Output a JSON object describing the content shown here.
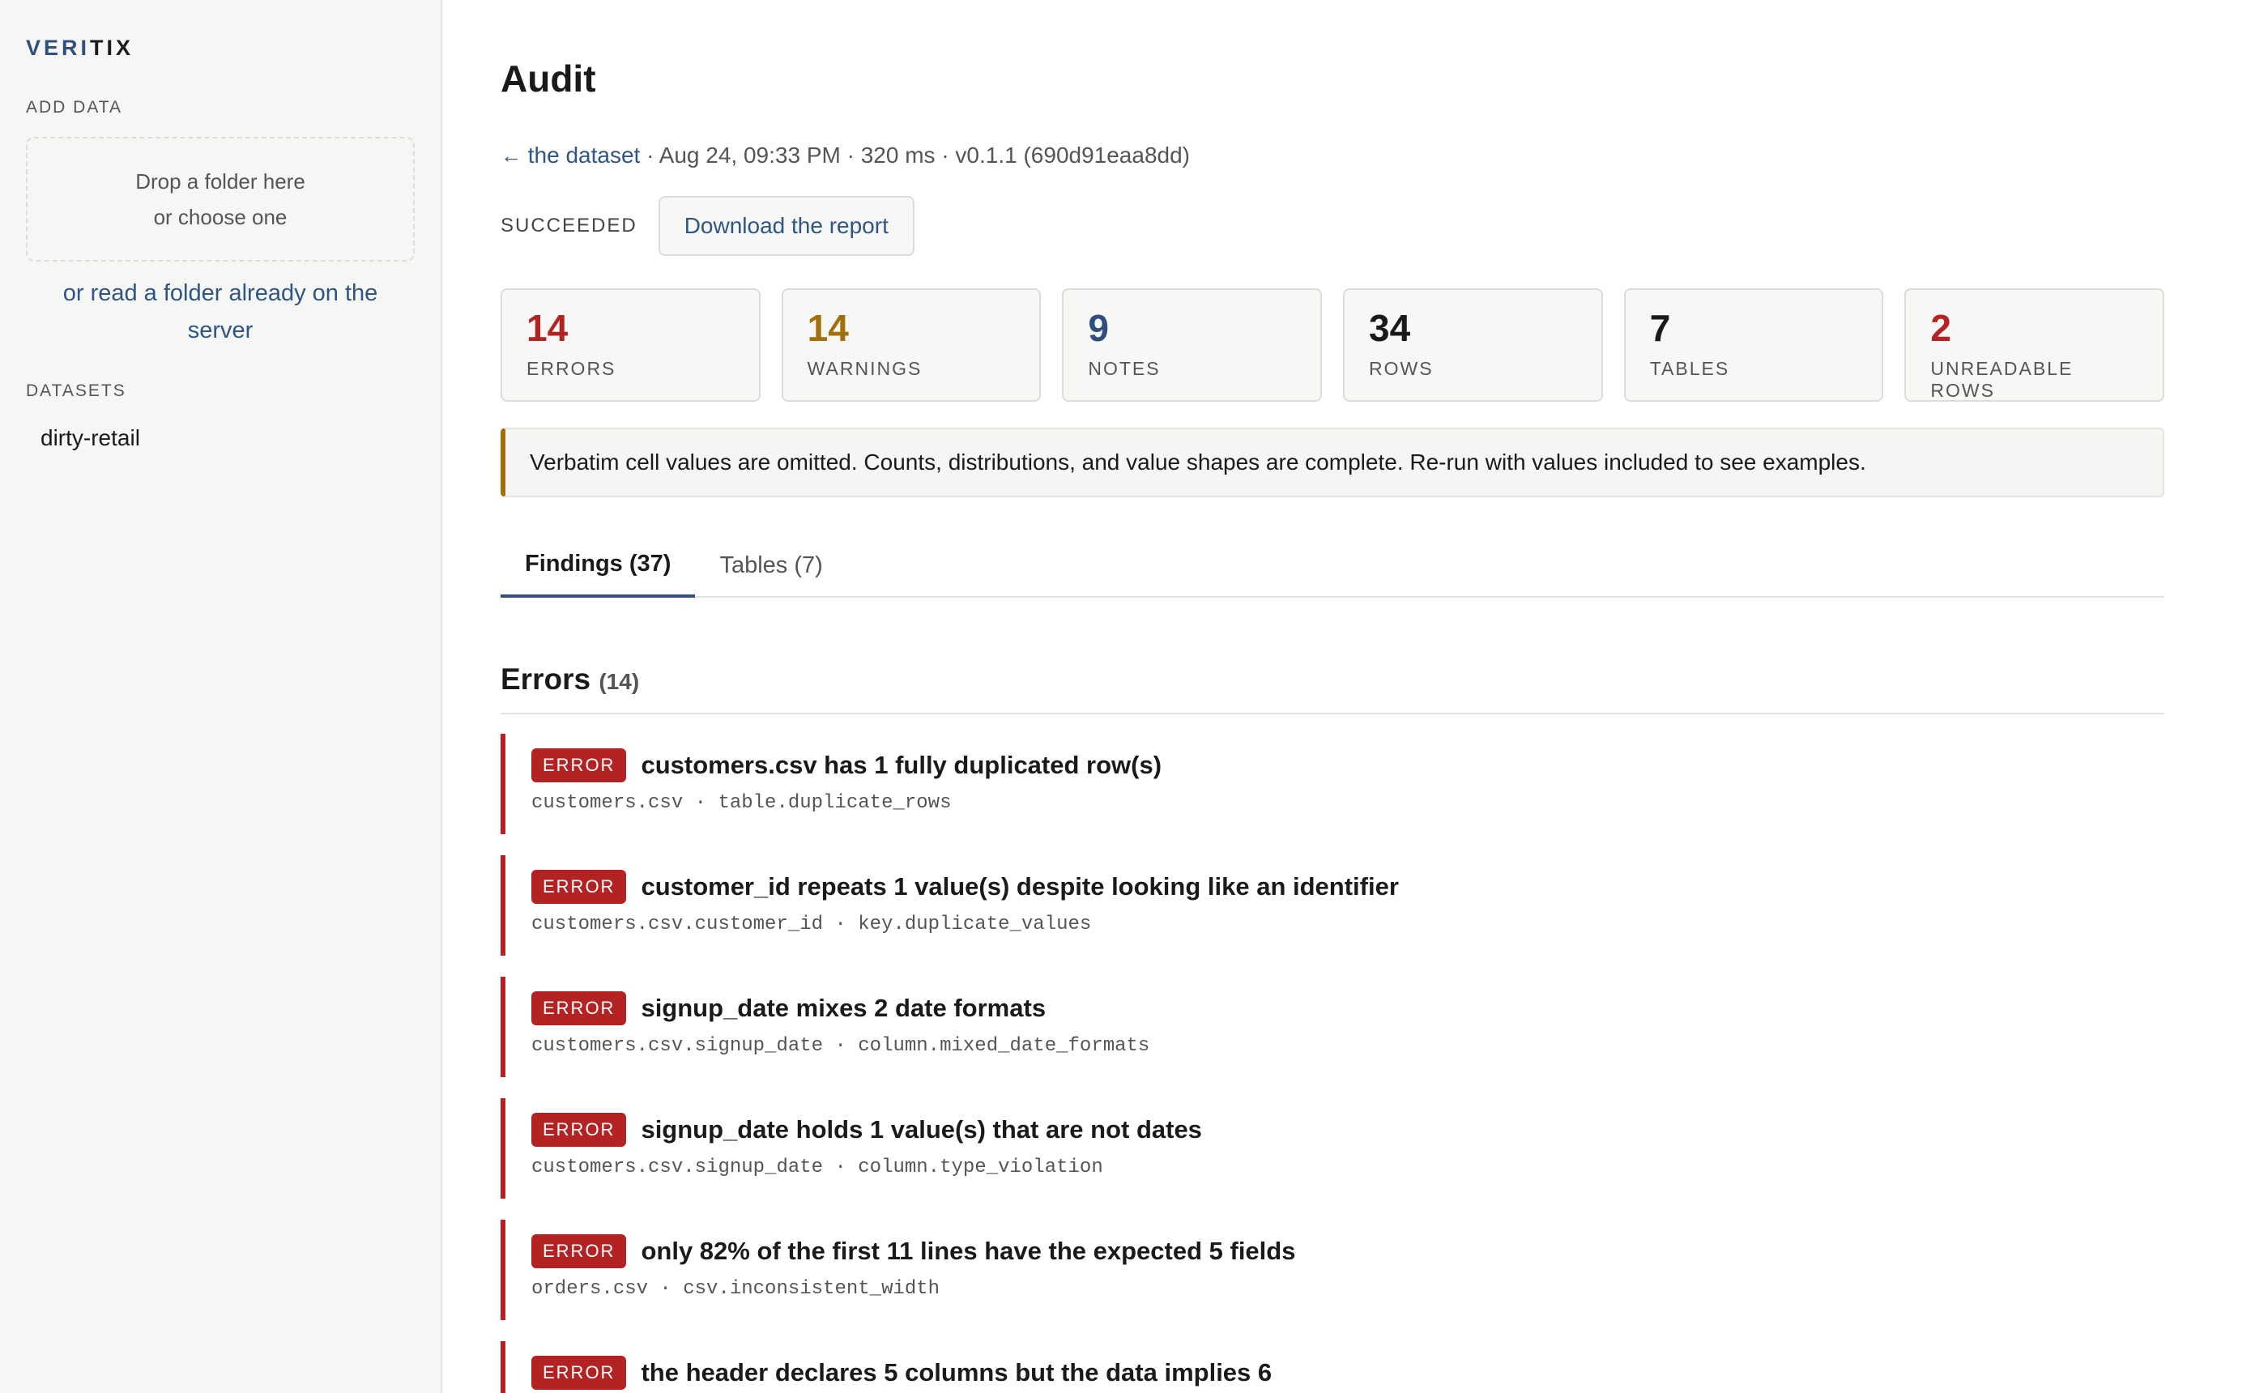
{
  "sidebar": {
    "logo_a": "VERI",
    "logo_b": "TIX",
    "add_data_label": "ADD DATA",
    "drop_line1": "Drop a folder here",
    "drop_line2": "or choose one",
    "server_link": "or read a folder already on the server",
    "datasets_label": "DATASETS",
    "datasets": [
      "dirty-retail"
    ]
  },
  "header": {
    "title": "Audit",
    "back_arrow": "←",
    "back_link": "the dataset",
    "meta_rest": " · Aug 24, 09:33 PM · 320 ms · v0.1.1 (690d91eaa8dd)",
    "status": "SUCCEEDED",
    "download_label": "Download the report"
  },
  "stats": [
    {
      "value": "14",
      "label": "ERRORS",
      "color": "#b42323"
    },
    {
      "value": "14",
      "label": "WARNINGS",
      "color": "#a36f0b"
    },
    {
      "value": "9",
      "label": "NOTES",
      "color": "#2f4f7f"
    },
    {
      "value": "34",
      "label": "ROWS",
      "color": "#1a1a1a"
    },
    {
      "value": "7",
      "label": "TABLES",
      "color": "#1a1a1a"
    },
    {
      "value": "2",
      "label": "UNREADABLE ROWS",
      "color": "#b42323"
    }
  ],
  "notice": "Verbatim cell values are omitted. Counts, distributions, and value shapes are complete. Re-run with values included to see examples.",
  "tabs": [
    {
      "label": "Findings (37)",
      "active": true
    },
    {
      "label": "Tables (7)",
      "active": false
    }
  ],
  "section": {
    "title": "Errors",
    "count": "(14)"
  },
  "findings": [
    {
      "badge": "ERROR",
      "title": "customers.csv has 1 fully duplicated row(s)",
      "sub": "customers.csv · table.duplicate_rows"
    },
    {
      "badge": "ERROR",
      "title": "customer_id repeats 1 value(s) despite looking like an identifier",
      "sub": "customers.csv.customer_id · key.duplicate_values"
    },
    {
      "badge": "ERROR",
      "title": "signup_date mixes 2 date formats",
      "sub": "customers.csv.signup_date · column.mixed_date_formats"
    },
    {
      "badge": "ERROR",
      "title": "signup_date holds 1 value(s) that are not dates",
      "sub": "customers.csv.signup_date · column.type_violation"
    },
    {
      "badge": "ERROR",
      "title": "only 82% of the first 11 lines have the expected 5 fields",
      "sub": "orders.csv · csv.inconsistent_width"
    },
    {
      "badge": "ERROR",
      "title": "the header declares 5 columns but the data implies 6",
      "sub": ""
    }
  ],
  "colors": {
    "accent": "#2f4f7f",
    "error": "#b42323",
    "warning": "#a36f0b"
  }
}
